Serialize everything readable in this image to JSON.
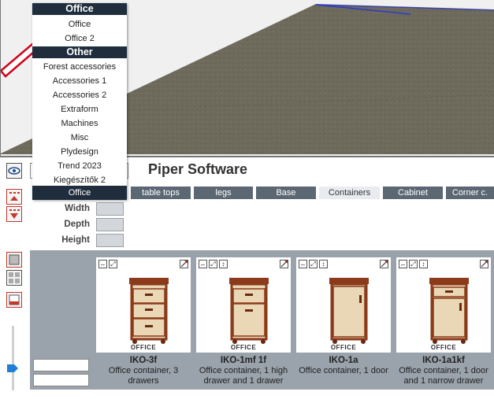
{
  "menu": {
    "section1": "Office",
    "items1": [
      "Office",
      "Office 2"
    ],
    "section2": "Other",
    "items2": [
      "Forest accessories",
      "Accessories 1",
      "Accessories 2",
      "Extraform",
      "Machines",
      "Misc",
      "Plydesign",
      "Trend 2023",
      "Kiegészítők 2"
    ],
    "selected": "Office"
  },
  "header": {
    "title": "Piper Software"
  },
  "tabs": [
    "table tops",
    "legs",
    "Base",
    "Containers",
    "Cabinet",
    "Corner c."
  ],
  "active_tab": "Containers",
  "dims": {
    "width": "Width",
    "depth": "Depth",
    "height": "Height"
  },
  "products": [
    {
      "brand": "OFFICE",
      "name": "IKO-3f",
      "desc": "Office container, 3 drawers"
    },
    {
      "brand": "OFFICE",
      "name": "IKO-1mf 1f",
      "desc": "Office container, 1 high drawer and 1 drawer"
    },
    {
      "brand": "OFFICE",
      "name": "IKO-1a",
      "desc": "Office container, 1 door"
    },
    {
      "brand": "OFFICE",
      "name": "IKO-1a1kf",
      "desc": "Office container, 1 door and 1 narrow drawer"
    }
  ],
  "icons": {
    "width_arrow": "↔",
    "expand": "⤢",
    "height_arrow": "↕"
  },
  "colors": {
    "menu_header": "#1f2d3d",
    "tab": "#5b6773",
    "accent_arrow": "#d0021b",
    "slider": "#1e7fd8"
  }
}
